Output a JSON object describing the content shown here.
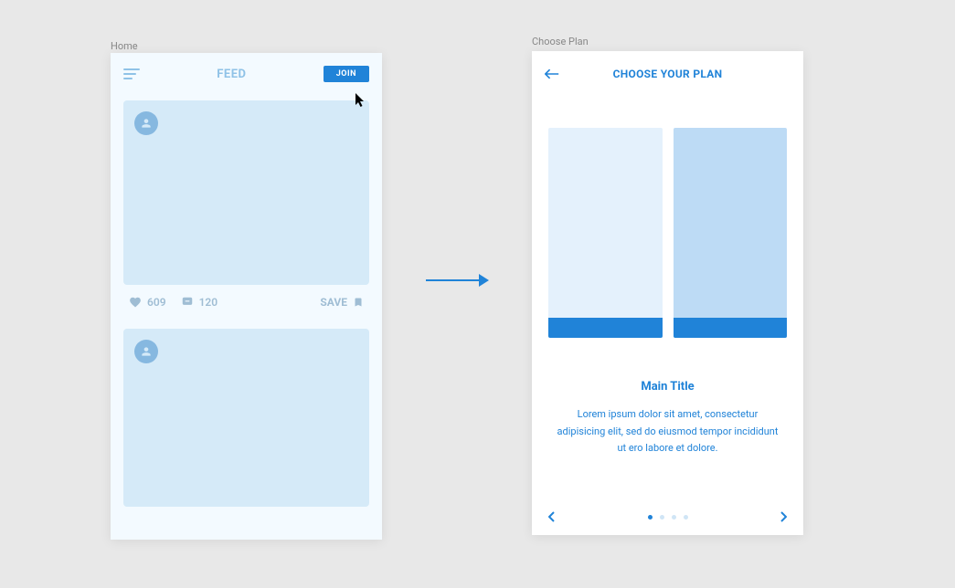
{
  "frames": {
    "home_label": "Home",
    "choose_label": "Choose Plan"
  },
  "home": {
    "header_title": "FEED",
    "join_button": "JOIN",
    "card1": {
      "likes": "609",
      "comments": "120",
      "save": "SAVE"
    }
  },
  "choose": {
    "header_title": "CHOOSE YOUR PLAN",
    "main_title": "Main Title",
    "description": "Lorem ipsum dolor sit amet, consectetur adipisicing elit, sed do eiusmod tempor incididunt ut ero labore et dolore.",
    "dots": 4,
    "active_dot": 0
  },
  "colors": {
    "accent": "#2083D8",
    "light_blue": "#D5EAF8",
    "muted_blue": "#8FC2E7"
  }
}
